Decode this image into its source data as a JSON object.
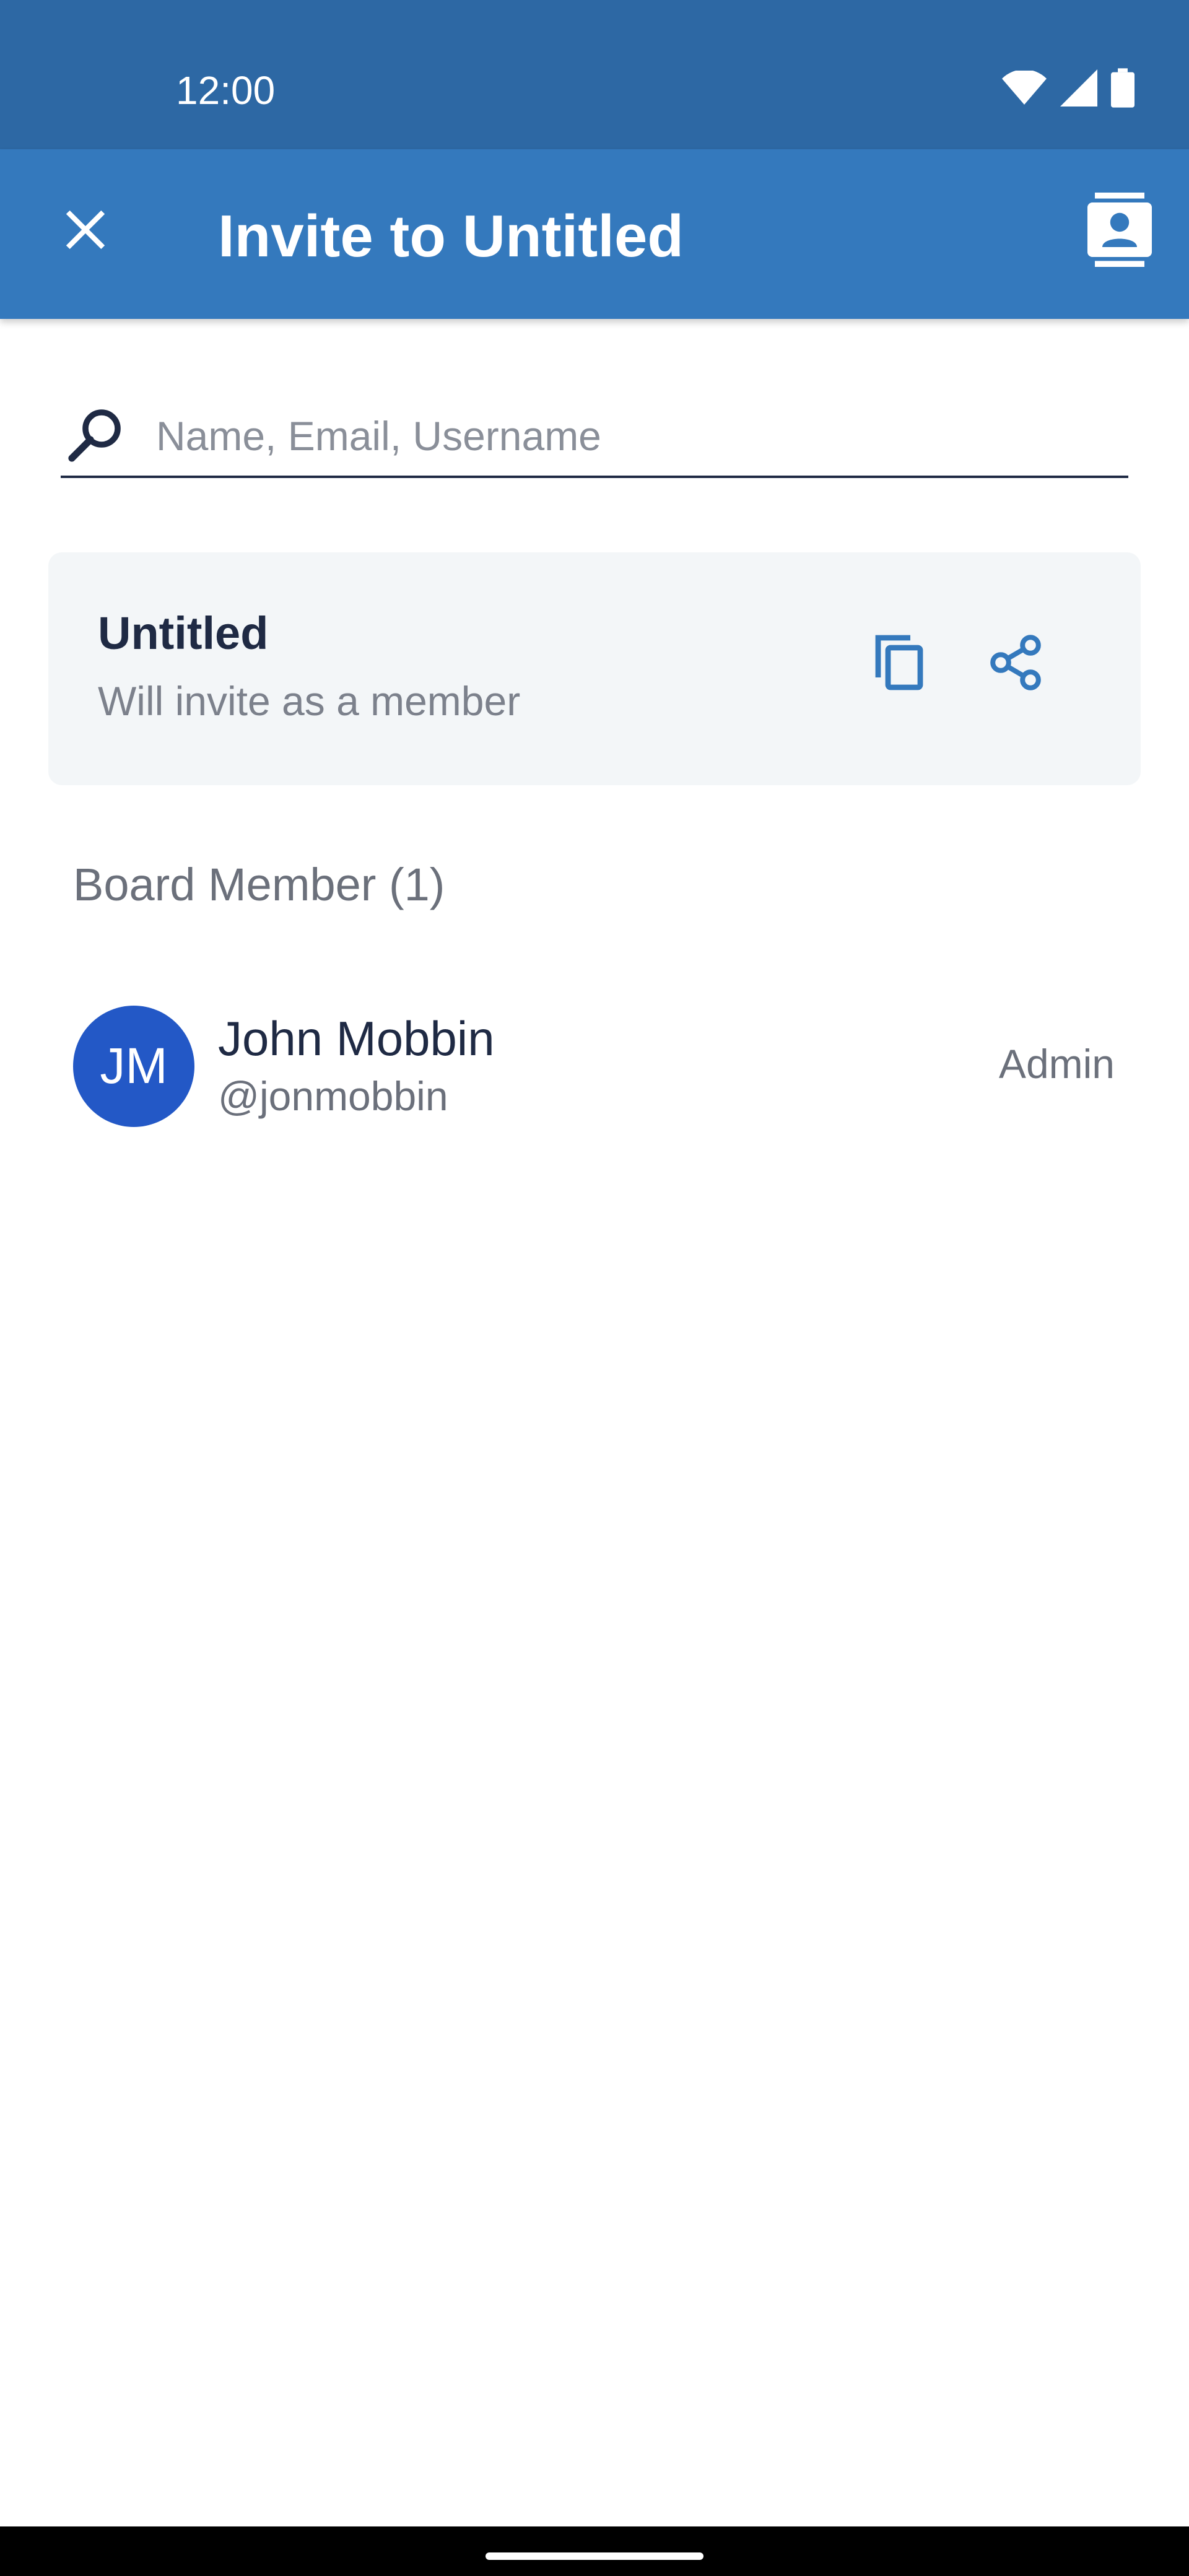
{
  "status_bar": {
    "time": "12:00",
    "icons": [
      "wifi-icon",
      "signal-icon",
      "battery-icon"
    ]
  },
  "app_bar": {
    "title": "Invite to Untitled",
    "close_icon": "close-icon",
    "contacts_icon": "contacts-icon",
    "color": "#3479bd"
  },
  "search": {
    "placeholder": "Name, Email, Username",
    "value": ""
  },
  "invite_card": {
    "title": "Untitled",
    "subtitle": "Will invite as a member",
    "copy_icon": "copy-icon",
    "share_icon": "share-icon"
  },
  "members_section": {
    "title": "Board Member (1)",
    "members": [
      {
        "initials": "JM",
        "name": "John Mobbin",
        "handle": "@jonmobbin",
        "role": "Admin",
        "avatar_color": "#2358c6"
      }
    ]
  }
}
